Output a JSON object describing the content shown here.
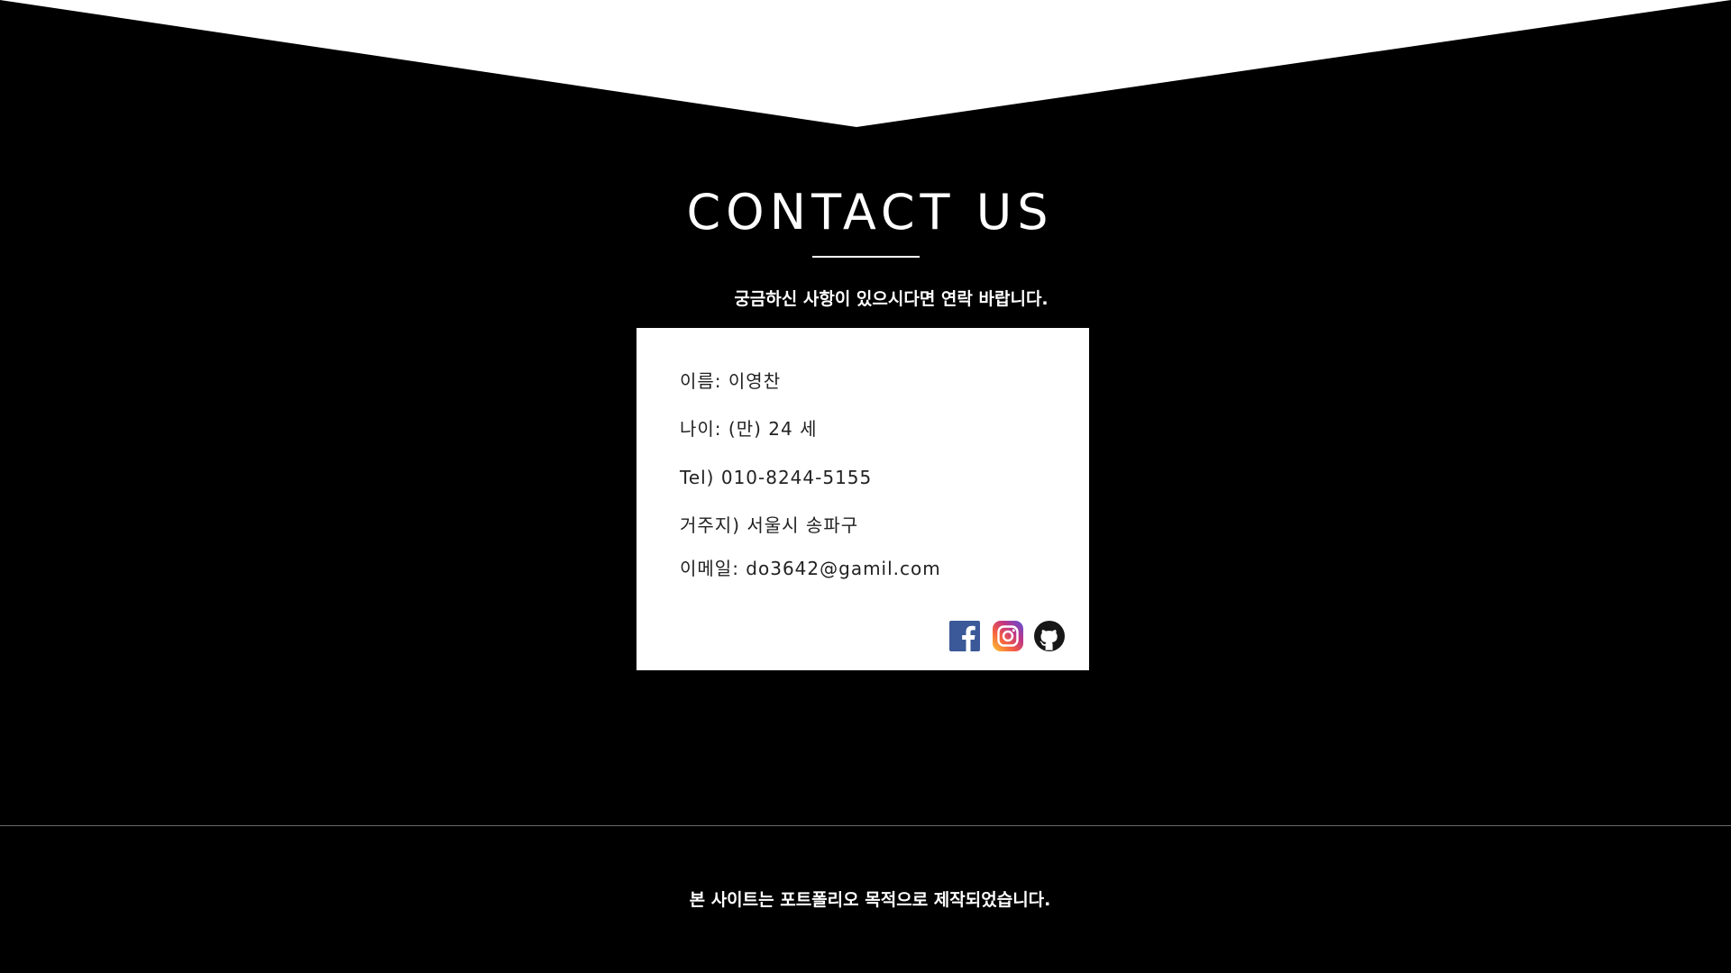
{
  "contact": {
    "title": "CONTACT US",
    "subtitle": "궁금하신 사항이 있으시다면 연락 바랍니다.",
    "info": {
      "name": "이름: 이영찬",
      "age": "나이: (만) 24 세",
      "tel": "Tel) 010-8244-5155",
      "address": "거주지) 서울시 송파구",
      "email": "이메일: do3642@gamil.com"
    },
    "social_icons": [
      "facebook-icon",
      "instagram-icon",
      "github-icon"
    ]
  },
  "footer": {
    "text": "본 사이트는 포트폴리오 목적으로 제작되었습니다."
  },
  "colors": {
    "background": "#000000",
    "card": "#ffffff",
    "text_light": "#ffffff",
    "text_dark": "#222222",
    "facebook": "#3b5998",
    "github": "#181717"
  }
}
